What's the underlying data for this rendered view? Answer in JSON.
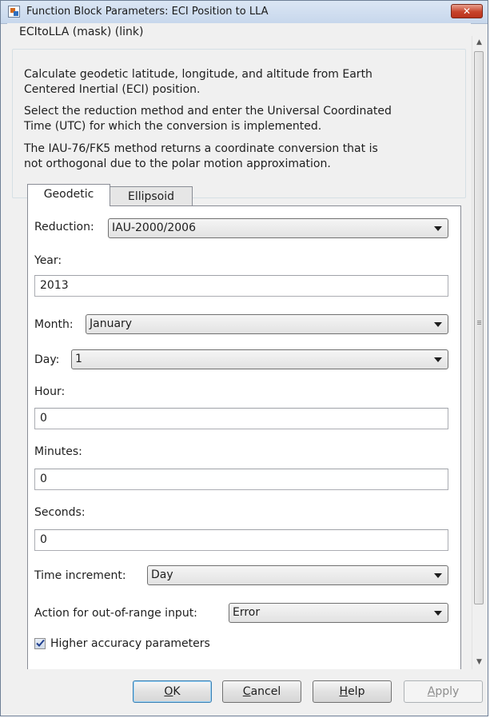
{
  "window": {
    "title": "Function Block Parameters: ECI Position to LLA",
    "close_symbol": "✕",
    "icon": "simulink-block-icon",
    "close_color": "#c7432b"
  },
  "group": {
    "title": "ECItoLLA (mask) (link)",
    "description_lines": [
      "Calculate geodetic latitude, longitude, and altitude from Earth",
      "Centered Inertial (ECI) position.",
      "Select the reduction method and enter the Universal Coordinated",
      "Time (UTC) for which the conversion is implemented.",
      "The IAU-76/FK5 method returns a coordinate conversion that is",
      "not orthogonal due to the polar motion approximation."
    ]
  },
  "tabs": [
    {
      "label": "Geodetic",
      "active": true
    },
    {
      "label": "Ellipsoid",
      "active": false
    }
  ],
  "params": {
    "reduction": {
      "label": "Reduction:",
      "value": "IAU-2000/2006"
    },
    "year": {
      "label": "Year:",
      "value": "2013"
    },
    "month": {
      "label": "Month:",
      "value": "January"
    },
    "day": {
      "label": "Day:",
      "value": "1"
    },
    "hour": {
      "label": "Hour:",
      "value": "0"
    },
    "minutes": {
      "label": "Minutes:",
      "value": "0"
    },
    "seconds": {
      "label": "Seconds:",
      "value": "0"
    },
    "time_increment": {
      "label": "Time increment:",
      "value": "Day"
    },
    "out_of_range": {
      "label": "Action for out-of-range input:",
      "value": "Error"
    },
    "higher_accuracy": {
      "label": "Higher accuracy parameters",
      "checked": true
    }
  },
  "buttons": {
    "ok": {
      "mnemonic": "O",
      "rest": "K"
    },
    "cancel": {
      "mnemonic": "C",
      "rest": "ancel"
    },
    "help": {
      "mnemonic": "H",
      "rest": "elp"
    },
    "apply": {
      "mnemonic": "A",
      "rest": "pply",
      "enabled": false
    }
  }
}
